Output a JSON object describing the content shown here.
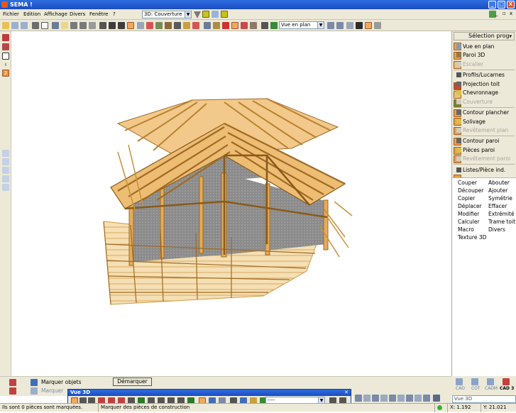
{
  "window": {
    "title": "SEMA !",
    "buttons": [
      "_",
      "□",
      "X"
    ]
  },
  "menu": {
    "items": [
      "Fichier",
      "Edition",
      "Affichage",
      "Divers",
      "Fenêtre",
      "?"
    ]
  },
  "toolbar": {
    "view_combo": "3D: Couverture",
    "plan_combo": "Vue en plan"
  },
  "left_toolbar": {
    "badge": "2"
  },
  "right_panel": {
    "header": "Sélection prog.",
    "sections": [
      {
        "items": [
          {
            "label": "Vue en plan",
            "enabled": true
          },
          {
            "label": "Paroi 3D",
            "enabled": true
          },
          {
            "label": "Escalier",
            "enabled": false
          }
        ]
      },
      {
        "items": [
          {
            "label": "Profils/Lucarnes",
            "enabled": true
          },
          {
            "label": "Projection toit",
            "enabled": true
          },
          {
            "label": "Chevronnage",
            "enabled": true
          },
          {
            "label": "Couverture",
            "enabled": false
          }
        ]
      },
      {
        "items": [
          {
            "label": "Contour plancher",
            "enabled": true
          },
          {
            "label": "Solivage",
            "enabled": true
          },
          {
            "label": "Revêtement plan",
            "enabled": false
          }
        ]
      },
      {
        "items": [
          {
            "label": "Contour paroi",
            "enabled": true
          },
          {
            "label": "Pièces paroi",
            "enabled": true
          },
          {
            "label": "Revêtement paroi",
            "enabled": false
          }
        ]
      },
      {
        "items": [
          {
            "label": "Listes/Pièce ind.",
            "enabled": true
          }
        ]
      }
    ],
    "commands_left": [
      "Couper",
      "Découper",
      "Copier",
      "Déplacer",
      "Modifier",
      "Calculer",
      "Macro",
      "Texture 3D"
    ],
    "commands_right": [
      "Abouter",
      "Ajouter",
      "Symétrie",
      "Effacer",
      "Extrémité",
      "Trame toit",
      "Divers"
    ]
  },
  "cad_tabs": [
    {
      "label": "CAO",
      "active": false
    },
    {
      "label": "COT",
      "active": false
    },
    {
      "label": "CADM",
      "active": false
    },
    {
      "label": "CAD 3",
      "active": true
    }
  ],
  "bottom_panel": {
    "marquer_objets": "Marquer objets",
    "marquer_cut": "Marquer",
    "demarquer_button": "Démarquer",
    "view_field": "Vue 3D",
    "dropdown_value": "----"
  },
  "vue3d_toolbar": {
    "title": "Vue 3D"
  },
  "status": {
    "left": "Ils sont 0 pièces sont marquées.",
    "center": "Marquer des pièces de construction",
    "x": "X: 1.192",
    "y": "Y: 21.021"
  },
  "colors": {
    "title_blue": "#1f57d0",
    "timber": "#e5ac58",
    "timber_dark": "#a06a22",
    "wall_gray": "#8e8e8e"
  }
}
